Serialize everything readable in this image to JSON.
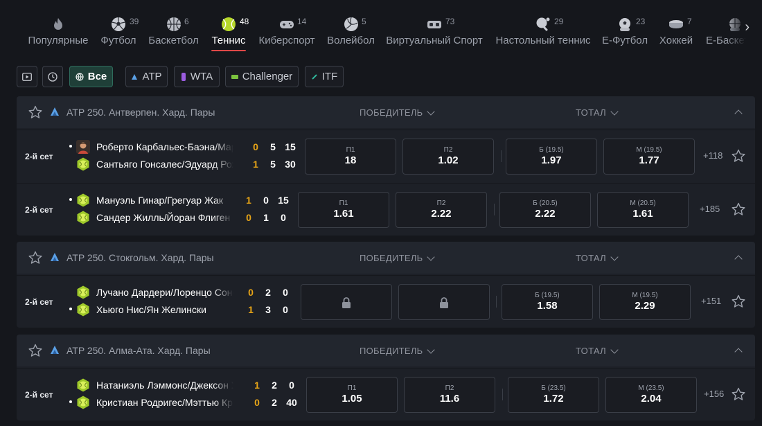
{
  "sports": [
    {
      "label": "Популярные",
      "count": "",
      "icon": "flame-icon"
    },
    {
      "label": "Футбол",
      "count": "39",
      "icon": "soccer-ball-icon"
    },
    {
      "label": "Баскетбол",
      "count": "6",
      "icon": "basketball-icon"
    },
    {
      "label": "Теннис",
      "count": "48",
      "icon": "tennis-ball-icon",
      "active": true
    },
    {
      "label": "Киберспорт",
      "count": "14",
      "icon": "gamepad-icon"
    },
    {
      "label": "Волейбол",
      "count": "5",
      "icon": "volleyball-icon"
    },
    {
      "label": "Виртуальный Спорт",
      "count": "73",
      "icon": "vr-headset-icon"
    },
    {
      "label": "Настольный теннис",
      "count": "29",
      "icon": "table-tennis-icon"
    },
    {
      "label": "Е-Футбол",
      "count": "23",
      "icon": "e-football-icon"
    },
    {
      "label": "Хоккей",
      "count": "7",
      "icon": "hockey-puck-icon"
    },
    {
      "label": "Е-Баскетбол",
      "count": "",
      "icon": "e-basketball-icon"
    }
  ],
  "nav_arrow": "›",
  "filters": {
    "all_label": "Все",
    "atp_label": "ATP",
    "wta_label": "WTA",
    "challenger_label": "Challenger",
    "itf_label": "ITF"
  },
  "columns": {
    "winner": "ПОБЕДИТЕЛЬ",
    "total": "ТОТАЛ"
  },
  "colors": {
    "accent_red": "#e04848",
    "active_green": "#1f3f38",
    "score_yellow": "#e8a517",
    "tennis_ball": "#b6d72a"
  },
  "leagues": [
    {
      "name": "ATP 250. Антверпен. Хард. Пары",
      "matches": [
        {
          "period": "2-й сет",
          "team1": {
            "name": "Роберто Карбальес-Баэна/Марсель Гранольерс",
            "set": "0",
            "games": "5",
            "points": "15",
            "serve": true,
            "avatar": "player-photo"
          },
          "team2": {
            "name": "Сантьяго Гонсалес/Эдуард Роже-Васслен",
            "set": "1",
            "games": "5",
            "points": "30",
            "serve": false,
            "avatar": "tennis-ball"
          },
          "odds": [
            {
              "label": "П1",
              "value": "18"
            },
            {
              "label": "П2",
              "value": "1.02"
            },
            {
              "label": "Б (19.5)",
              "value": "1.97"
            },
            {
              "label": "М (19.5)",
              "value": "1.77"
            }
          ],
          "more": "+118"
        },
        {
          "period": "2-й сет",
          "team1": {
            "name": "Мануэль Гинар/Грегуар Жак",
            "set": "1",
            "games": "0",
            "points": "15",
            "serve": true,
            "avatar": "tennis-ball"
          },
          "team2": {
            "name": "Сандер Жилль/Йоран Флиген",
            "set": "0",
            "games": "1",
            "points": "0",
            "serve": false,
            "avatar": "tennis-ball"
          },
          "odds": [
            {
              "label": "П1",
              "value": "1.61"
            },
            {
              "label": "П2",
              "value": "2.22"
            },
            {
              "label": "Б (20.5)",
              "value": "2.22"
            },
            {
              "label": "М (20.5)",
              "value": "1.61"
            }
          ],
          "more": "+185"
        }
      ]
    },
    {
      "name": "ATP 250. Стокгольм. Хард. Пары",
      "matches": [
        {
          "period": "2-й сет",
          "team1": {
            "name": "Лучано Дардери/Лоренцо Сонего",
            "set": "0",
            "games": "2",
            "points": "0",
            "serve": false,
            "avatar": "tennis-ball"
          },
          "team2": {
            "name": "Хьюго Нис/Ян Желински",
            "set": "1",
            "games": "3",
            "points": "0",
            "serve": true,
            "avatar": "tennis-ball"
          },
          "odds": [
            {
              "label": "",
              "value": "",
              "locked": true
            },
            {
              "label": "",
              "value": "",
              "locked": true
            },
            {
              "label": "Б (19.5)",
              "value": "1.58"
            },
            {
              "label": "М (19.5)",
              "value": "2.29"
            }
          ],
          "more": "+151"
        }
      ]
    },
    {
      "name": "ATP 250. Алма-Ата. Хард. Пары",
      "matches": [
        {
          "period": "2-й сет",
          "team1": {
            "name": "Натаниэль Лэммонс/Джексон Уизроу",
            "set": "1",
            "games": "2",
            "points": "0",
            "serve": false,
            "avatar": "tennis-ball"
          },
          "team2": {
            "name": "Кристиан Родригес/Мэттью Кристофер Романиос",
            "set": "0",
            "games": "2",
            "points": "40",
            "serve": true,
            "avatar": "tennis-ball"
          },
          "odds": [
            {
              "label": "П1",
              "value": "1.05"
            },
            {
              "label": "П2",
              "value": "11.6"
            },
            {
              "label": "Б (23.5)",
              "value": "1.72"
            },
            {
              "label": "М (23.5)",
              "value": "2.04"
            }
          ],
          "more": "+156"
        }
      ]
    }
  ]
}
